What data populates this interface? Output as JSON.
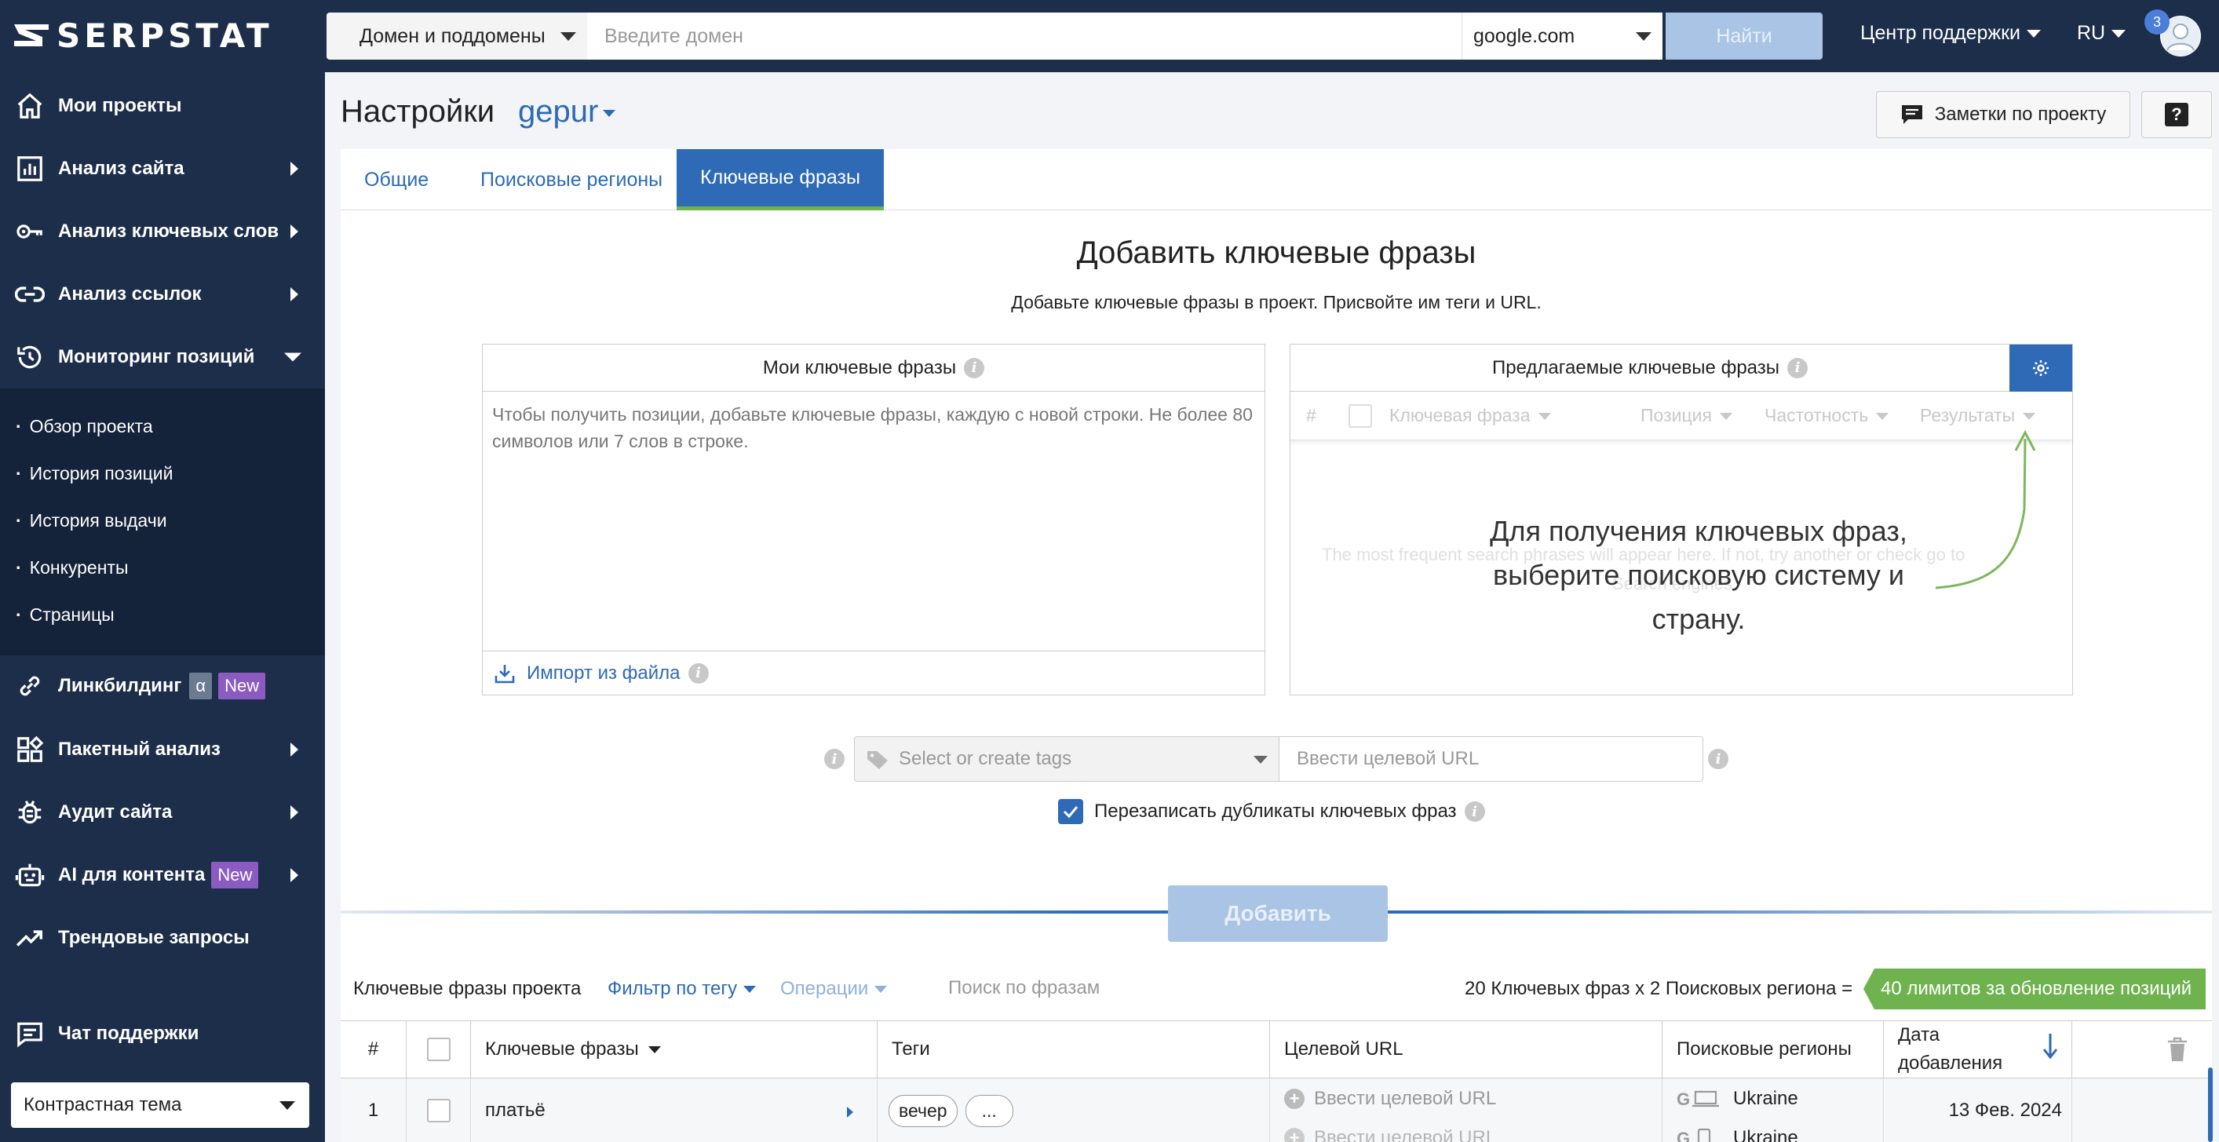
{
  "brand": {
    "logo_text": "SERPSTAT"
  },
  "sidebar": {
    "items": [
      {
        "label": "Мои проекты",
        "icon": "home-icon"
      },
      {
        "label": "Анализ сайта",
        "icon": "chart-icon"
      },
      {
        "label": "Анализ ключевых слов",
        "icon": "key-icon"
      },
      {
        "label": "Анализ ссылок",
        "icon": "link-icon"
      },
      {
        "label": "Мониторинг позиций",
        "icon": "history-icon"
      },
      {
        "label": "Линкбилдинг",
        "icon": "chain-icon",
        "badge_alpha": "α",
        "badge_new": "New"
      },
      {
        "label": "Пакетный анализ",
        "icon": "grid-icon"
      },
      {
        "label": "Аудит сайта",
        "icon": "bug-icon"
      },
      {
        "label": "AI для контента",
        "icon": "robot-icon",
        "badge_new": "New"
      },
      {
        "label": "Трендовые запросы",
        "icon": "trend-icon"
      },
      {
        "label": "Чат поддержки",
        "icon": "chat-icon"
      }
    ],
    "submenu": [
      "Обзор проекта",
      "История позиций",
      "История выдачи",
      "Конкуренты",
      "Страницы"
    ],
    "theme_select": "Контрастная тема"
  },
  "topbar": {
    "domain_type": "Домен и поддомены",
    "domain_placeholder": "Введите домен",
    "engine": "google.com",
    "find_label": "Найти",
    "support_label": "Центр поддержки",
    "lang_label": "RU",
    "notifications": "3"
  },
  "header": {
    "title": "Настройки",
    "project": "gepur",
    "notes_label": "Заметки по проекту",
    "help_label": "?"
  },
  "tabs": [
    "Общие",
    "Поисковые регионы",
    "Ключевые фразы"
  ],
  "add_section": {
    "title": "Добавить ключевые фразы",
    "subtitle": "Добавьте ключевые фразы в проект. Присвойте им теги и URL.",
    "my_keywords_title": "Мои ключевые фразы",
    "my_keywords_placeholder": "Чтобы получить позиции, добавьте ключевые фразы, каждую с новой строки. Не более 80 символов или 7 слов в строке.",
    "import_label": "Импорт из файла",
    "suggested_title": "Предлагаемые ключевые фразы",
    "suggested_columns": [
      "#",
      "Ключевая фраза",
      "Позиция",
      "Частотность",
      "Результаты"
    ],
    "suggested_ghost_1": "The most frequent search phrases will appear here. If not, try another or check go to",
    "suggested_ghost_2": "Search engines.",
    "suggested_message": "Для получения ключевых фраз, выберите поисковую систему и страну.",
    "tags_placeholder": "Select or create tags",
    "url_placeholder": "Ввести целевой URL",
    "overwrite_label": "Перезаписать дубликаты ключевых фраз",
    "overwrite_checked": true,
    "add_label": "Добавить"
  },
  "list": {
    "title": "Ключевые фразы проекта",
    "filter_label": "Фильтр по тегу",
    "operations_label": "Операции",
    "search_placeholder": "Поиск по фразам",
    "summary": "20 Ключевых фраз x 2 Поисковых региона =",
    "limits": "40 лимитов за обновление позиций",
    "columns": [
      "#",
      "",
      "Ключевые фразы",
      "Теги",
      "Целевой URL",
      "Поисковые регионы",
      "Дата добавления",
      ""
    ],
    "rows": [
      {
        "num": "1",
        "keyword": "платьё",
        "tags": [
          "вечер",
          "..."
        ],
        "url_lines": [
          "Ввести целевой URL",
          "Ввести целевой URL"
        ],
        "regions": [
          "Ukraine",
          "Ukraine"
        ],
        "date": "13 Фев. 2024"
      }
    ]
  },
  "colors": {
    "sidebar_bg": "#1c2e4a",
    "accent": "#2e6ab5",
    "limits_green": "#6fb34f",
    "new_badge": "#8b5bc2"
  }
}
